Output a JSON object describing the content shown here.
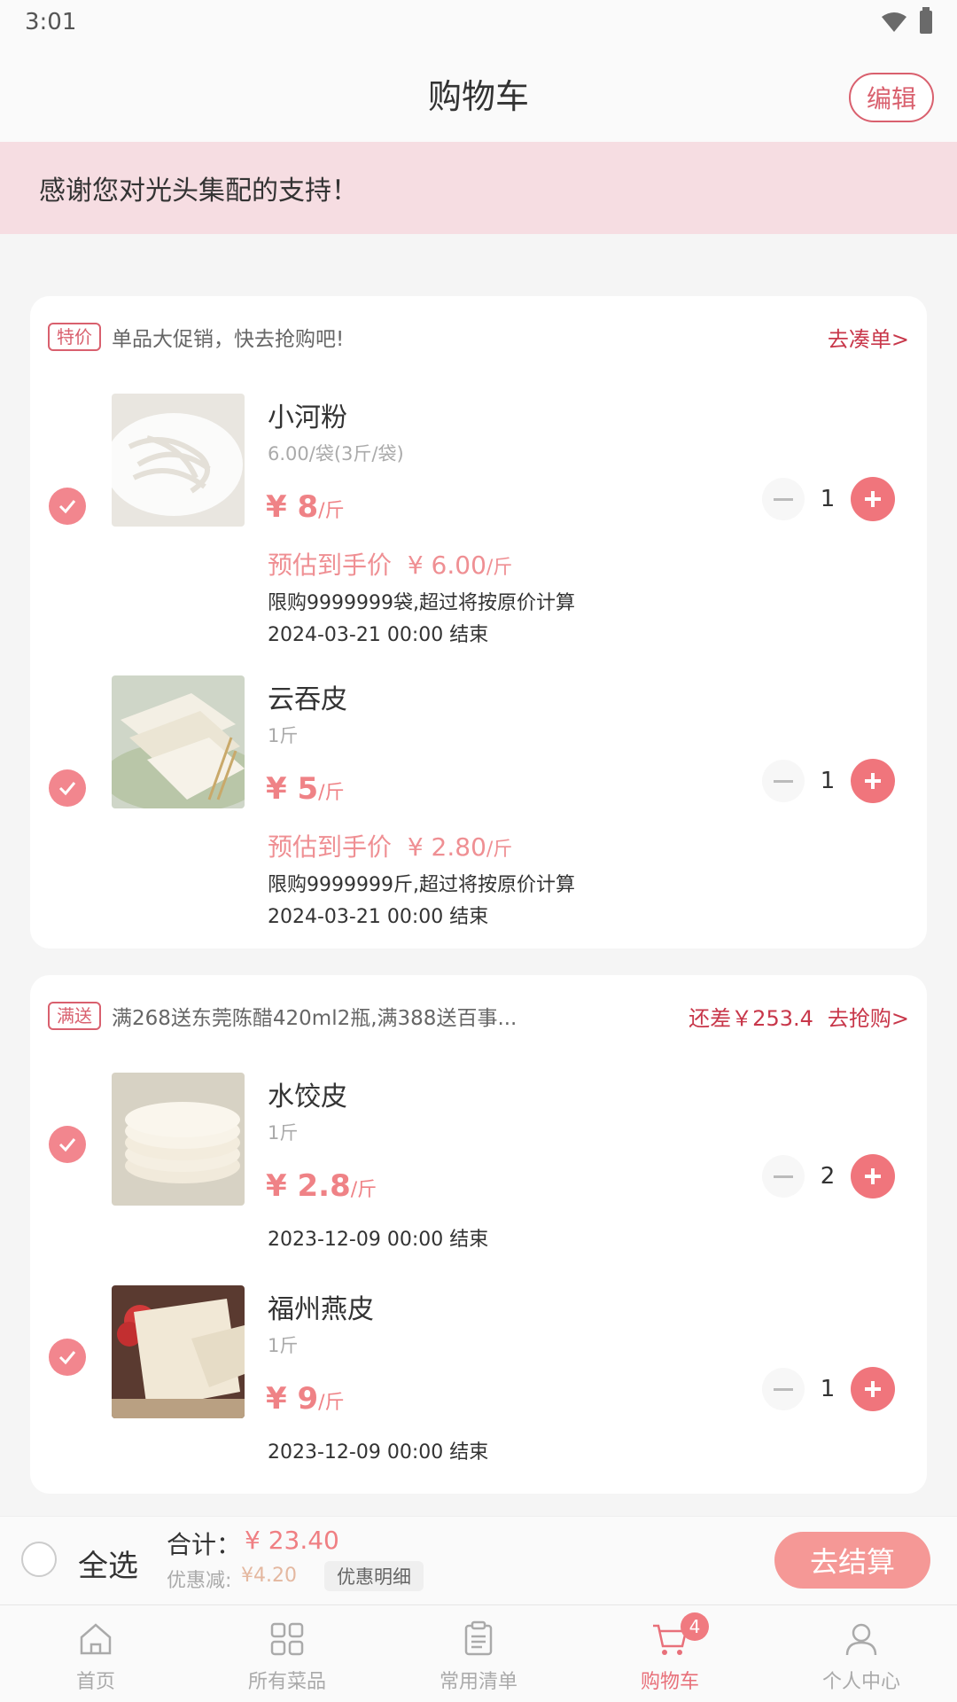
{
  "status_bar": {
    "time": "3:01"
  },
  "header": {
    "title": "购物车",
    "edit_label": "编辑"
  },
  "banner": {
    "text": "感谢您对光头集配的支持！"
  },
  "groups": [
    {
      "tag": "特价",
      "promo_text": "单品大促销，快去抢购吧!",
      "link": "去凑单>",
      "items": [
        {
          "name": "小河粉",
          "spec": "6.00/袋(3斤/袋)",
          "price": "¥ 8",
          "unit": "/斤",
          "est_label": "预估到手价",
          "est_price": "¥ 6.00",
          "est_unit": "/斤",
          "limit": "限购9999999袋,超过将按原价计算",
          "ends": "2024-03-21 00:00 结束",
          "qty": "1",
          "checked": true
        },
        {
          "name": "云吞皮",
          "spec": "1斤",
          "price": "¥ 5",
          "unit": "/斤",
          "est_label": "预估到手价",
          "est_price": "¥ 2.80",
          "est_unit": "/斤",
          "limit": "限购9999999斤,超过将按原价计算",
          "ends": "2024-03-21 00:00 结束",
          "qty": "1",
          "checked": true
        }
      ]
    },
    {
      "tag": "满送",
      "promo_text": "满268送东莞陈醋420ml2瓶,满388送百事...",
      "diff": "还差￥253.4",
      "link": "去抢购>",
      "items": [
        {
          "name": "水饺皮",
          "spec": "1斤",
          "price": "¥ 2.8",
          "unit": "/斤",
          "ends": "2023-12-09 00:00 结束",
          "qty": "2",
          "checked": true
        },
        {
          "name": "福州燕皮",
          "spec": "1斤",
          "price": "¥ 9",
          "unit": "/斤",
          "ends": "2023-12-09 00:00 结束",
          "qty": "1",
          "checked": true
        }
      ]
    }
  ],
  "footer": {
    "select_all": "全选",
    "total_label": "合计：",
    "total_value": "¥ 23.40",
    "discount_label": "优惠减:",
    "discount_value": "¥4.20",
    "discount_detail": "优惠明细",
    "checkout": "去结算"
  },
  "tabs": [
    {
      "label": "首页",
      "icon": "home-icon",
      "active": false
    },
    {
      "label": "所有菜品",
      "icon": "grid-icon",
      "active": false
    },
    {
      "label": "常用清单",
      "icon": "clipboard-icon",
      "active": false
    },
    {
      "label": "购物车",
      "icon": "cart-icon",
      "active": true,
      "badge": "4"
    },
    {
      "label": "个人中心",
      "icon": "user-icon",
      "active": false
    }
  ],
  "colors": {
    "accent": "#f0757c",
    "banner_bg": "#f6dde2",
    "link": "#c8374a"
  }
}
